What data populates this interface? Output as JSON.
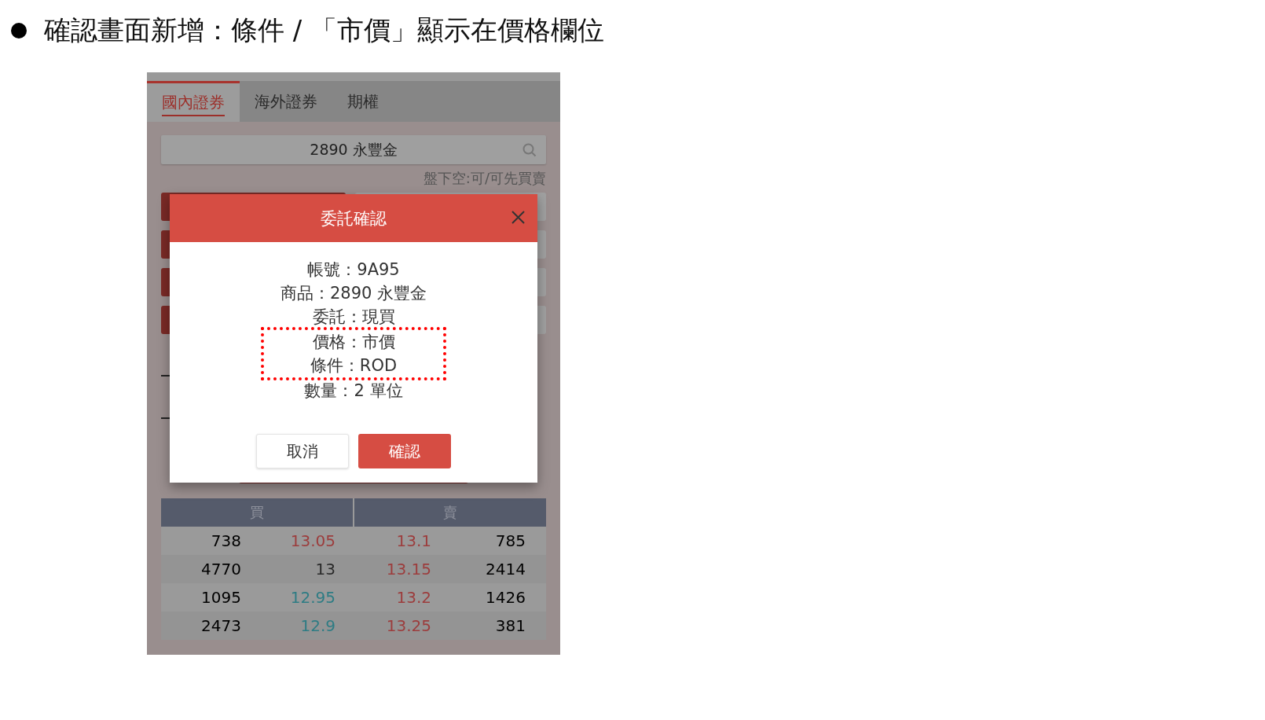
{
  "headline": {
    "text": "確認畫面新增：條件 / 「市價」顯示在價格欄位"
  },
  "app": {
    "tabs": [
      {
        "label": "國內證券",
        "selected": true
      },
      {
        "label": "海外證券",
        "selected": false
      },
      {
        "label": "期權",
        "selected": false
      }
    ],
    "search": {
      "value": "2890 永豐金"
    },
    "short_sell_note": "盤下空:可/可先買賣",
    "order_book": {
      "columns": [
        "買",
        "賣"
      ],
      "rows": [
        {
          "bid_volume": "738",
          "bid_price": {
            "text": "13.05",
            "color": "#9c3d3d"
          },
          "ask_price": {
            "text": "13.1",
            "color": "#9c3d3d"
          },
          "ask_volume": "785"
        },
        {
          "bid_volume": "4770",
          "bid_price": {
            "text": "13",
            "color": "#2a2a2a"
          },
          "ask_price": {
            "text": "13.15",
            "color": "#9c3d3d"
          },
          "ask_volume": "2414"
        },
        {
          "bid_volume": "1095",
          "bid_price": {
            "text": "12.95",
            "color": "#2e7c84"
          },
          "ask_price": {
            "text": "13.2",
            "color": "#9c3d3d"
          },
          "ask_volume": "1426"
        },
        {
          "bid_volume": "2473",
          "bid_price": {
            "text": "12.9",
            "color": "#2e7c84"
          },
          "ask_price": {
            "text": "13.25",
            "color": "#9c3d3d"
          },
          "ask_volume": "381"
        }
      ]
    }
  },
  "dialog": {
    "title": "委託確認",
    "lines": [
      {
        "text": "帳號：9A95",
        "highlighted": false
      },
      {
        "text": "商品：2890 永豐金",
        "highlighted": false
      },
      {
        "text": "委託：現買",
        "highlighted": false
      },
      {
        "text": "價格：市價",
        "highlighted": true
      },
      {
        "text": "條件：ROD",
        "highlighted": true
      },
      {
        "text": "數量：2 單位",
        "highlighted": false
      }
    ],
    "buttons": [
      {
        "label": "取消",
        "kind": "secondary"
      },
      {
        "label": "確認",
        "kind": "primary"
      }
    ]
  }
}
